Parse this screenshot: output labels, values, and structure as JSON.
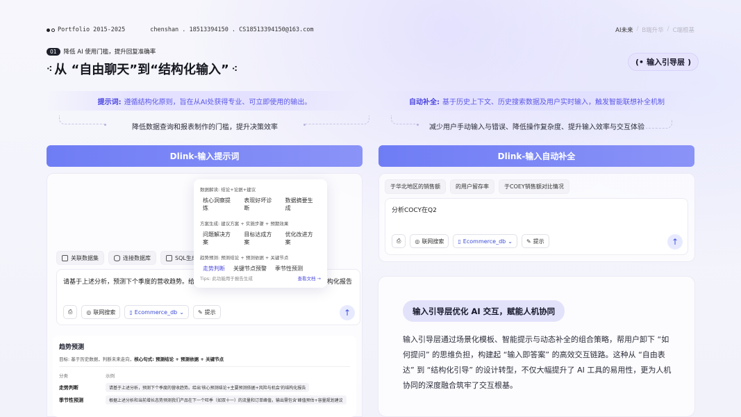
{
  "topbar": {
    "portfolio": "Portfolio 2015-2025",
    "contact": "chenshan . 18513394150 . CS18513394150@163.com",
    "crumbs": [
      "AI未来",
      "B端升华",
      "C端根基"
    ]
  },
  "header": {
    "num": "01",
    "tagline": "降低 AI 使用门槛，提升回复准确率",
    "title": "从 “自由聊天”到“结构化输入”",
    "badge": "输入引导层",
    "badge_open": "(•",
    "badge_close": ")"
  },
  "left": {
    "strip_label": "提示词:",
    "strip_text": "遵循结构化原则，旨在从AI处获得专业、可立即使用的输出。",
    "sub": "降低数据查询和报表制作的门槛，提升决策效率",
    "bar": "Dlink-输入提示词",
    "chips": [
      "关联数据集",
      "连接数据库",
      "SQL生成"
    ],
    "input_text_a": "请基于上述分析，预测下个季度的营收趋势。给",
    "input_text_b": "构化报告",
    "tools": {
      "search": "联网搜索",
      "db": "Ecommerce_db",
      "hint": "提示"
    },
    "popover": {
      "groups": [
        {
          "label": "数据解读: 结论+论据+建议",
          "items": [
            "核心洞察提炼",
            "表现好坏诊断",
            "数据摘要生成"
          ]
        },
        {
          "label": "方案生成: 建议方案 + 实施步骤 + 预期效果",
          "items": [
            "问题解决方案",
            "目标达成方案",
            "优化改进方案"
          ]
        },
        {
          "label": "趋势预测: 预测结论 + 预测依据 + 关键节点",
          "items": [
            "走势判断",
            "关键节点预警",
            "季节性预测"
          ]
        }
      ],
      "tips": "Tips: 此功能用于报告生成",
      "doc": "查看文档 →"
    },
    "trend": {
      "title": "趋势预测",
      "goal_prefix": "目标:  基于历史数据，判断未来走向，",
      "goal_bold": "核心句式: 预测结论 + 预测依据 + 关键节点",
      "col_cat": "分类",
      "col_ex": "示例",
      "rows": [
        {
          "cat": "走势判断",
          "ex": "请基于上述分析，预测下个季度的营收趋势。给出'核心预测结论+主要预测依据+风险与机会'的结构化报告"
        },
        {
          "cat": "季节性预测",
          "ex": "根据上述分析和当前增长态势预测我们产品在下一个旺季（如双十一）的流量和订单峰值，输出需包含'峰值预估+容量规划建议"
        }
      ]
    }
  },
  "right": {
    "strip_label": "自动补全:",
    "strip_text": "基于历史上下文、历史搜索数据及用户实时输入，触发智能联想补全机制",
    "sub": "减少用户手动输入与错误、降低操作复杂度、提升输入效率与交互体验",
    "bar": "Dlink-输入自动补全",
    "suggestions": [
      "于华北地区的销售额",
      "的用户留存率",
      "于COEY销售额对比情况"
    ],
    "input_text": "分析COCY在Q2",
    "tools": {
      "search": "联网搜索",
      "db": "Ecommerce_db",
      "hint": "提示"
    },
    "card_pill": "输入引导层优化 AI 交互，赋能人机协同",
    "card_text": "输入引导层通过场景化模板、智能提示与动态补全的组合策略，帮用户卸下 “如何提问” 的思维负担，构建起 “输入即答案” 的高效交互链路。这种从 “自由表达” 到 “结构化引导” 的设计转型，不仅大幅提升了 AI 工具的易用性，更为人机协同的深度融合筑牢了交互根基。"
  },
  "colors": {
    "accent": "#5b57e8",
    "bar_start": "#6f7df5",
    "bar_end": "#8a93f7"
  }
}
